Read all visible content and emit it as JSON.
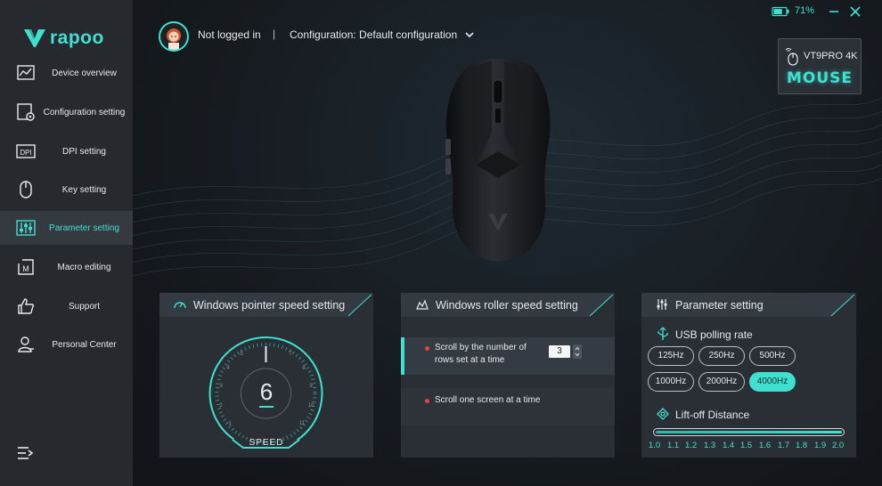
{
  "brand": {
    "logo_text": "rapoo"
  },
  "sidebar": {
    "items": [
      {
        "label": "Device overview",
        "icon": "chart-icon"
      },
      {
        "label": "Configuration setting",
        "icon": "settings-doc-icon"
      },
      {
        "label": "DPI setting",
        "icon": "dpi-icon"
      },
      {
        "label": "Key setting",
        "icon": "mouse-icon"
      },
      {
        "label": "Parameter setting",
        "icon": "sliders-icon",
        "active": true
      },
      {
        "label": "Macro editing",
        "icon": "macro-icon"
      },
      {
        "label": "Support",
        "icon": "thumbs-up-icon"
      },
      {
        "label": "Personal Center",
        "icon": "user-icon"
      }
    ]
  },
  "header": {
    "login_status": "Not logged in",
    "separator": "|",
    "configuration": "Configuration: Default configuration"
  },
  "status": {
    "battery_percent": "71%",
    "battery_level": 0.71
  },
  "device": {
    "model": "VT9PRO 4K",
    "type": "MOUSE"
  },
  "panels": {
    "pointer": {
      "title": "Windows pointer speed setting",
      "value": "6",
      "speed_label": "SPEED"
    },
    "roller": {
      "title": "Windows roller speed setting",
      "option_rows": "Scroll by the number of rows set at a time",
      "rows_value": "3",
      "option_screen": "Scroll one screen at a time"
    },
    "parameter": {
      "title": "Parameter setting",
      "usb_polling_label": "USB polling rate",
      "rates": [
        "125Hz",
        "250Hz",
        "500Hz",
        "1000Hz",
        "2000Hz",
        "4000Hz"
      ],
      "selected_rate": "4000Hz",
      "lift_off_label": "Lift-off Distance",
      "lift_off_ticks": [
        "1.0",
        "1.1",
        "1.2",
        "1.3",
        "1.4",
        "1.5",
        "1.6",
        "1.7",
        "1.8",
        "1.9",
        "2.0"
      ]
    }
  },
  "colors": {
    "accent": "#3fe0d0",
    "sidebar": "#262a2f",
    "panel": "#2a2f35",
    "dot": "#e0463f"
  }
}
